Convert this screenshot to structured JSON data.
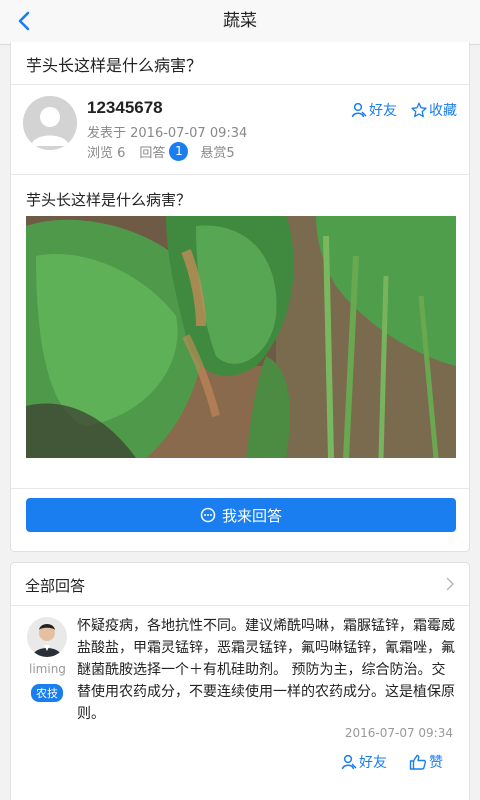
{
  "navbar": {
    "title": "蔬菜",
    "back_icon": "chevron-left-icon"
  },
  "question": {
    "heading": "芋头长这样是什么病害？",
    "user": {
      "name": "12345678",
      "posted": "发表于 2016-07-07 09:34"
    },
    "stats": {
      "views": "浏览 6",
      "answers_label": "回答",
      "answers_count": "1",
      "reward": "悬赏5"
    },
    "actions": {
      "friend": "好友",
      "collect": "收藏"
    },
    "text": "芋头长这样是什么病害？",
    "photo_alt": "taro leaves photo",
    "answer_button": "我来回答"
  },
  "answers": {
    "header": "全部回答",
    "items": [
      {
        "name": "liming",
        "tag": "农技",
        "text": "怀疑疫病，各地抗性不同。建议烯酰吗啉，霜脲锰锌，霜霉威盐酸盐，甲霜灵锰锌，恶霜灵锰锌，氟吗啉锰锌，氰霜唑，氟醚菌酰胺选择一个＋有机硅助剂。 预防为主，综合防治。交替使用农药成分，不要连续使用一样的农药成分。这是植保原则。",
        "time": "2016-07-07 09:34",
        "friend": "好友",
        "like": "赞"
      }
    ]
  },
  "colors": {
    "accent": "#1a7ef0",
    "background": "#f2f2f2"
  }
}
